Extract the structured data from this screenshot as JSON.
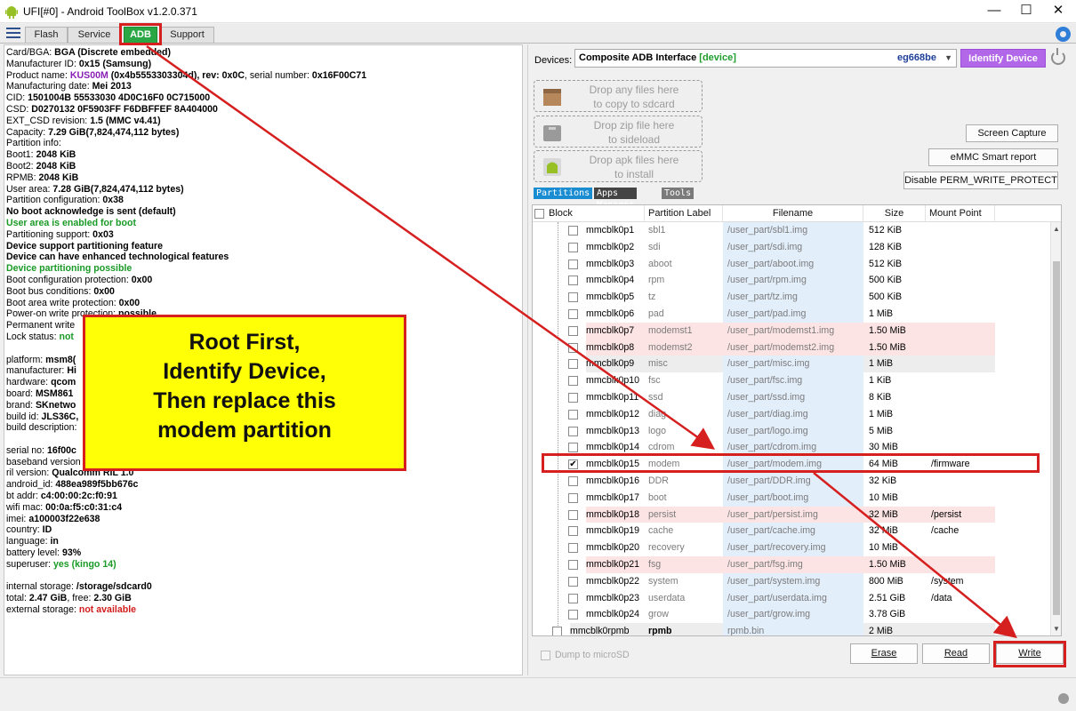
{
  "window": {
    "title": "UFI[#0] - Android ToolBox v1.2.0.371",
    "minimize": "—",
    "maximize": "☐",
    "close": "✕"
  },
  "tabs": [
    "Flash",
    "Service",
    "ADB",
    "Support"
  ],
  "active_tab": "ADB",
  "info": {
    "card_bga_lbl": "Card/BGA: ",
    "card_bga_val": "BGA (Discrete embedded)",
    "mfr_lbl": "Manufacturer ID: ",
    "mfr_val": "0x15 (Samsung)",
    "product_lbl": "Product name: ",
    "product_name": "KUS00M",
    "product_rest": " (0x4b5553303304d), rev: ",
    "product_rev": "0x0C",
    "product_sn_lbl": ", serial number: ",
    "product_sn": "0x16F00C71",
    "mdate_lbl": "Manufacturing date: ",
    "mdate_val": "Mei 2013",
    "cid_lbl": "CID: ",
    "cid_val": "1501004B 55533030 4D0C16F0 0C715000",
    "csd_lbl": "CSD: ",
    "csd_val": "D0270132 0F5903FF F6DBFFEF 8A404000",
    "extcsd_lbl": "EXT_CSD revision: ",
    "extcsd_val": "1.5 (MMC v4.41)",
    "cap_lbl": "Capacity: ",
    "cap_val": "7.29 GiB(7,824,474,112 bytes)",
    "pinfo": "Partition info:",
    "boot1_lbl": " Boot1: ",
    "boot1_val": "2048 KiB",
    "boot2_lbl": " Boot2: ",
    "boot2_val": "2048 KiB",
    "rpmb_lbl": " RPMB: ",
    "rpmb_val": "2048 KiB",
    "userarea_lbl": " User area: ",
    "userarea_val": "7.28 GiB(7,824,474,112 bytes)",
    "pconf_lbl": "Partition configuration: ",
    "pconf_val": "0x38",
    "noboot": " No boot acknowledge is sent (default)",
    "userboot": " User area is enabled for boot",
    "psupport_lbl": "Partitioning support: ",
    "psupport_val": "0x03",
    "devsupport": " Device support partitioning feature",
    "devenhanced": " Device can have enhanced technological features",
    "devpossible": " Device partitioning possible",
    "bootcfg_lbl": "Boot configuration protection: ",
    "bootcfg_val": "0x00",
    "bootbus_lbl": "Boot bus conditions: ",
    "bootbus_val": "0x00",
    "bootwp_lbl": "Boot area write protection: ",
    "bootwp_val": "0x00",
    "powerwp_lbl": " Power-on write protection: ",
    "powerwp_val": "possible",
    "permwp_lbl": " Permanent write",
    "lock_lbl": " Lock status: ",
    "lock_val": "not",
    "platform_lbl": "platform: ",
    "platform_val": "msm8(",
    "manufacturer_lbl": " manufacturer: ",
    "manufacturer_val": "Hi",
    "hardware_lbl": " hardware: ",
    "hardware_val": "qcom",
    "board_lbl": " board: ",
    "board_val": "MSM861",
    "brand_lbl": " brand: ",
    "brand_val": "SKnetwo",
    "buildid_lbl": " build id: ",
    "buildid_val": "JLS36C,",
    "builddesc_lbl": " build description:",
    "serial_lbl": "serial no: ",
    "serial_val": "16f00c",
    "baseband_lbl": "baseband version",
    "ril_lbl": "ril version: ",
    "ril_val": "Qualcomm RIL 1.0",
    "androidid_lbl": "android_id: ",
    "androidid_val": "488ea989f5bb676c",
    "btaddr_lbl": "bt addr: ",
    "btaddr_val": "c4:00:00:2c:f0:91",
    "wifimac_lbl": "wifi mac: ",
    "wifimac_val": "00:0a:f5:c0:31:c4",
    "imei_lbl": "imei: ",
    "imei_val": "a100003f22e638",
    "country_lbl": "country: ",
    "country_val": "ID",
    "language_lbl": "language: ",
    "language_val": "in",
    "battery_lbl": "battery level: ",
    "battery_val": "93%",
    "superuser_lbl": "superuser: ",
    "superuser_val": "yes (kingo 14)",
    "intstorage_lbl": "internal storage: ",
    "intstorage_val": "/storage/sdcard0",
    "total_lbl": " total: ",
    "total_val": "2.47 GiB",
    "free_lbl": ", free: ",
    "free_val": "2.30 GiB",
    "extstorage_lbl": "external storage: ",
    "extstorage_val": "not available"
  },
  "device": {
    "label": "Devices:",
    "interface": "Composite ADB Interface",
    "state": "[device]",
    "serial": "eg668be",
    "identify_label": "Identify Device"
  },
  "dropzones": [
    {
      "line1": "Drop any files here",
      "line2": "to copy to sdcard"
    },
    {
      "line1": "Drop zip file here",
      "line2": "to sideload"
    },
    {
      "line1": "Drop apk files here",
      "line2": "to install"
    }
  ],
  "side_buttons": {
    "screen_capture": "Screen Capture",
    "emmc_report": "eMMC Smart report",
    "disable_wp": "Disable PERM_WRITE_PROTECT"
  },
  "subtabs": [
    "Partitions",
    "Apps Manager",
    "Tools"
  ],
  "table": {
    "headers": [
      "Block",
      "Partition Label",
      "Filename",
      "Size",
      "Mount Point"
    ],
    "rows": [
      {
        "block": "mmcblk0p1",
        "label": "sbl1",
        "file": "/user_part/sbl1.img",
        "size": "512 KiB",
        "mount": "",
        "checked": false,
        "tint": "none"
      },
      {
        "block": "mmcblk0p2",
        "label": "sdi",
        "file": "/user_part/sdi.img",
        "size": "128 KiB",
        "mount": "",
        "checked": false,
        "tint": "none"
      },
      {
        "block": "mmcblk0p3",
        "label": "aboot",
        "file": "/user_part/aboot.img",
        "size": "512 KiB",
        "mount": "",
        "checked": false,
        "tint": "none"
      },
      {
        "block": "mmcblk0p4",
        "label": "rpm",
        "file": "/user_part/rpm.img",
        "size": "500 KiB",
        "mount": "",
        "checked": false,
        "tint": "none"
      },
      {
        "block": "mmcblk0p5",
        "label": "tz",
        "file": "/user_part/tz.img",
        "size": "500 KiB",
        "mount": "",
        "checked": false,
        "tint": "none"
      },
      {
        "block": "mmcblk0p6",
        "label": "pad",
        "file": "/user_part/pad.img",
        "size": "1 MiB",
        "mount": "",
        "checked": false,
        "tint": "none"
      },
      {
        "block": "mmcblk0p7",
        "label": "modemst1",
        "file": "/user_part/modemst1.img",
        "size": "1.50 MiB",
        "mount": "",
        "checked": false,
        "tint": "pink"
      },
      {
        "block": "mmcblk0p8",
        "label": "modemst2",
        "file": "/user_part/modemst2.img",
        "size": "1.50 MiB",
        "mount": "",
        "checked": false,
        "tint": "pink"
      },
      {
        "block": "mmcblk0p9",
        "label": "misc",
        "file": "/user_part/misc.img",
        "size": "1 MiB",
        "mount": "",
        "checked": false,
        "tint": "gray"
      },
      {
        "block": "mmcblk0p10",
        "label": "fsc",
        "file": "/user_part/fsc.img",
        "size": "1 KiB",
        "mount": "",
        "checked": false,
        "tint": "none"
      },
      {
        "block": "mmcblk0p11",
        "label": "ssd",
        "file": "/user_part/ssd.img",
        "size": "8 KiB",
        "mount": "",
        "checked": false,
        "tint": "none"
      },
      {
        "block": "mmcblk0p12",
        "label": "diag",
        "file": "/user_part/diag.img",
        "size": "1 MiB",
        "mount": "",
        "checked": false,
        "tint": "none"
      },
      {
        "block": "mmcblk0p13",
        "label": "logo",
        "file": "/user_part/logo.img",
        "size": "5 MiB",
        "mount": "",
        "checked": false,
        "tint": "none"
      },
      {
        "block": "mmcblk0p14",
        "label": "cdrom",
        "file": "/user_part/cdrom.img",
        "size": "30 MiB",
        "mount": "",
        "checked": false,
        "tint": "none"
      },
      {
        "block": "mmcblk0p15",
        "label": "modem",
        "file": "/user_part/modem.img",
        "size": "64 MiB",
        "mount": "/firmware",
        "checked": true,
        "tint": "none"
      },
      {
        "block": "mmcblk0p16",
        "label": "DDR",
        "file": "/user_part/DDR.img",
        "size": "32 KiB",
        "mount": "",
        "checked": false,
        "tint": "none"
      },
      {
        "block": "mmcblk0p17",
        "label": "boot",
        "file": "/user_part/boot.img",
        "size": "10 MiB",
        "mount": "",
        "checked": false,
        "tint": "none"
      },
      {
        "block": "mmcblk0p18",
        "label": "persist",
        "file": "/user_part/persist.img",
        "size": "32 MiB",
        "mount": "/persist",
        "checked": false,
        "tint": "pink"
      },
      {
        "block": "mmcblk0p19",
        "label": "cache",
        "file": "/user_part/cache.img",
        "size": "32 MiB",
        "mount": "/cache",
        "checked": false,
        "tint": "none"
      },
      {
        "block": "mmcblk0p20",
        "label": "recovery",
        "file": "/user_part/recovery.img",
        "size": "10 MiB",
        "mount": "",
        "checked": false,
        "tint": "none"
      },
      {
        "block": "mmcblk0p21",
        "label": "fsg",
        "file": "/user_part/fsg.img",
        "size": "1.50 MiB",
        "mount": "",
        "checked": false,
        "tint": "pink"
      },
      {
        "block": "mmcblk0p22",
        "label": "system",
        "file": "/user_part/system.img",
        "size": "800 MiB",
        "mount": "/system",
        "checked": false,
        "tint": "none"
      },
      {
        "block": "mmcblk0p23",
        "label": "userdata",
        "file": "/user_part/userdata.img",
        "size": "2.51 GiB",
        "mount": "/data",
        "checked": false,
        "tint": "none"
      },
      {
        "block": "mmcblk0p24",
        "label": "grow",
        "file": "/user_part/grow.img",
        "size": "3.78 GiB",
        "mount": "",
        "checked": false,
        "tint": "none"
      },
      {
        "block": "mmcblk0rpmb",
        "label": "rpmb",
        "file": "rpmb.bin",
        "size": "2 MiB",
        "mount": "",
        "checked": false,
        "tint": "gray",
        "top_level": true
      }
    ]
  },
  "bottom": {
    "dump_label": "Dump to microSD",
    "erase": "Erase",
    "read": "Read",
    "write": "Write"
  },
  "annotation": {
    "lines": [
      "Root First,",
      "Identify Device,",
      "Then replace this",
      "modem partition"
    ]
  }
}
